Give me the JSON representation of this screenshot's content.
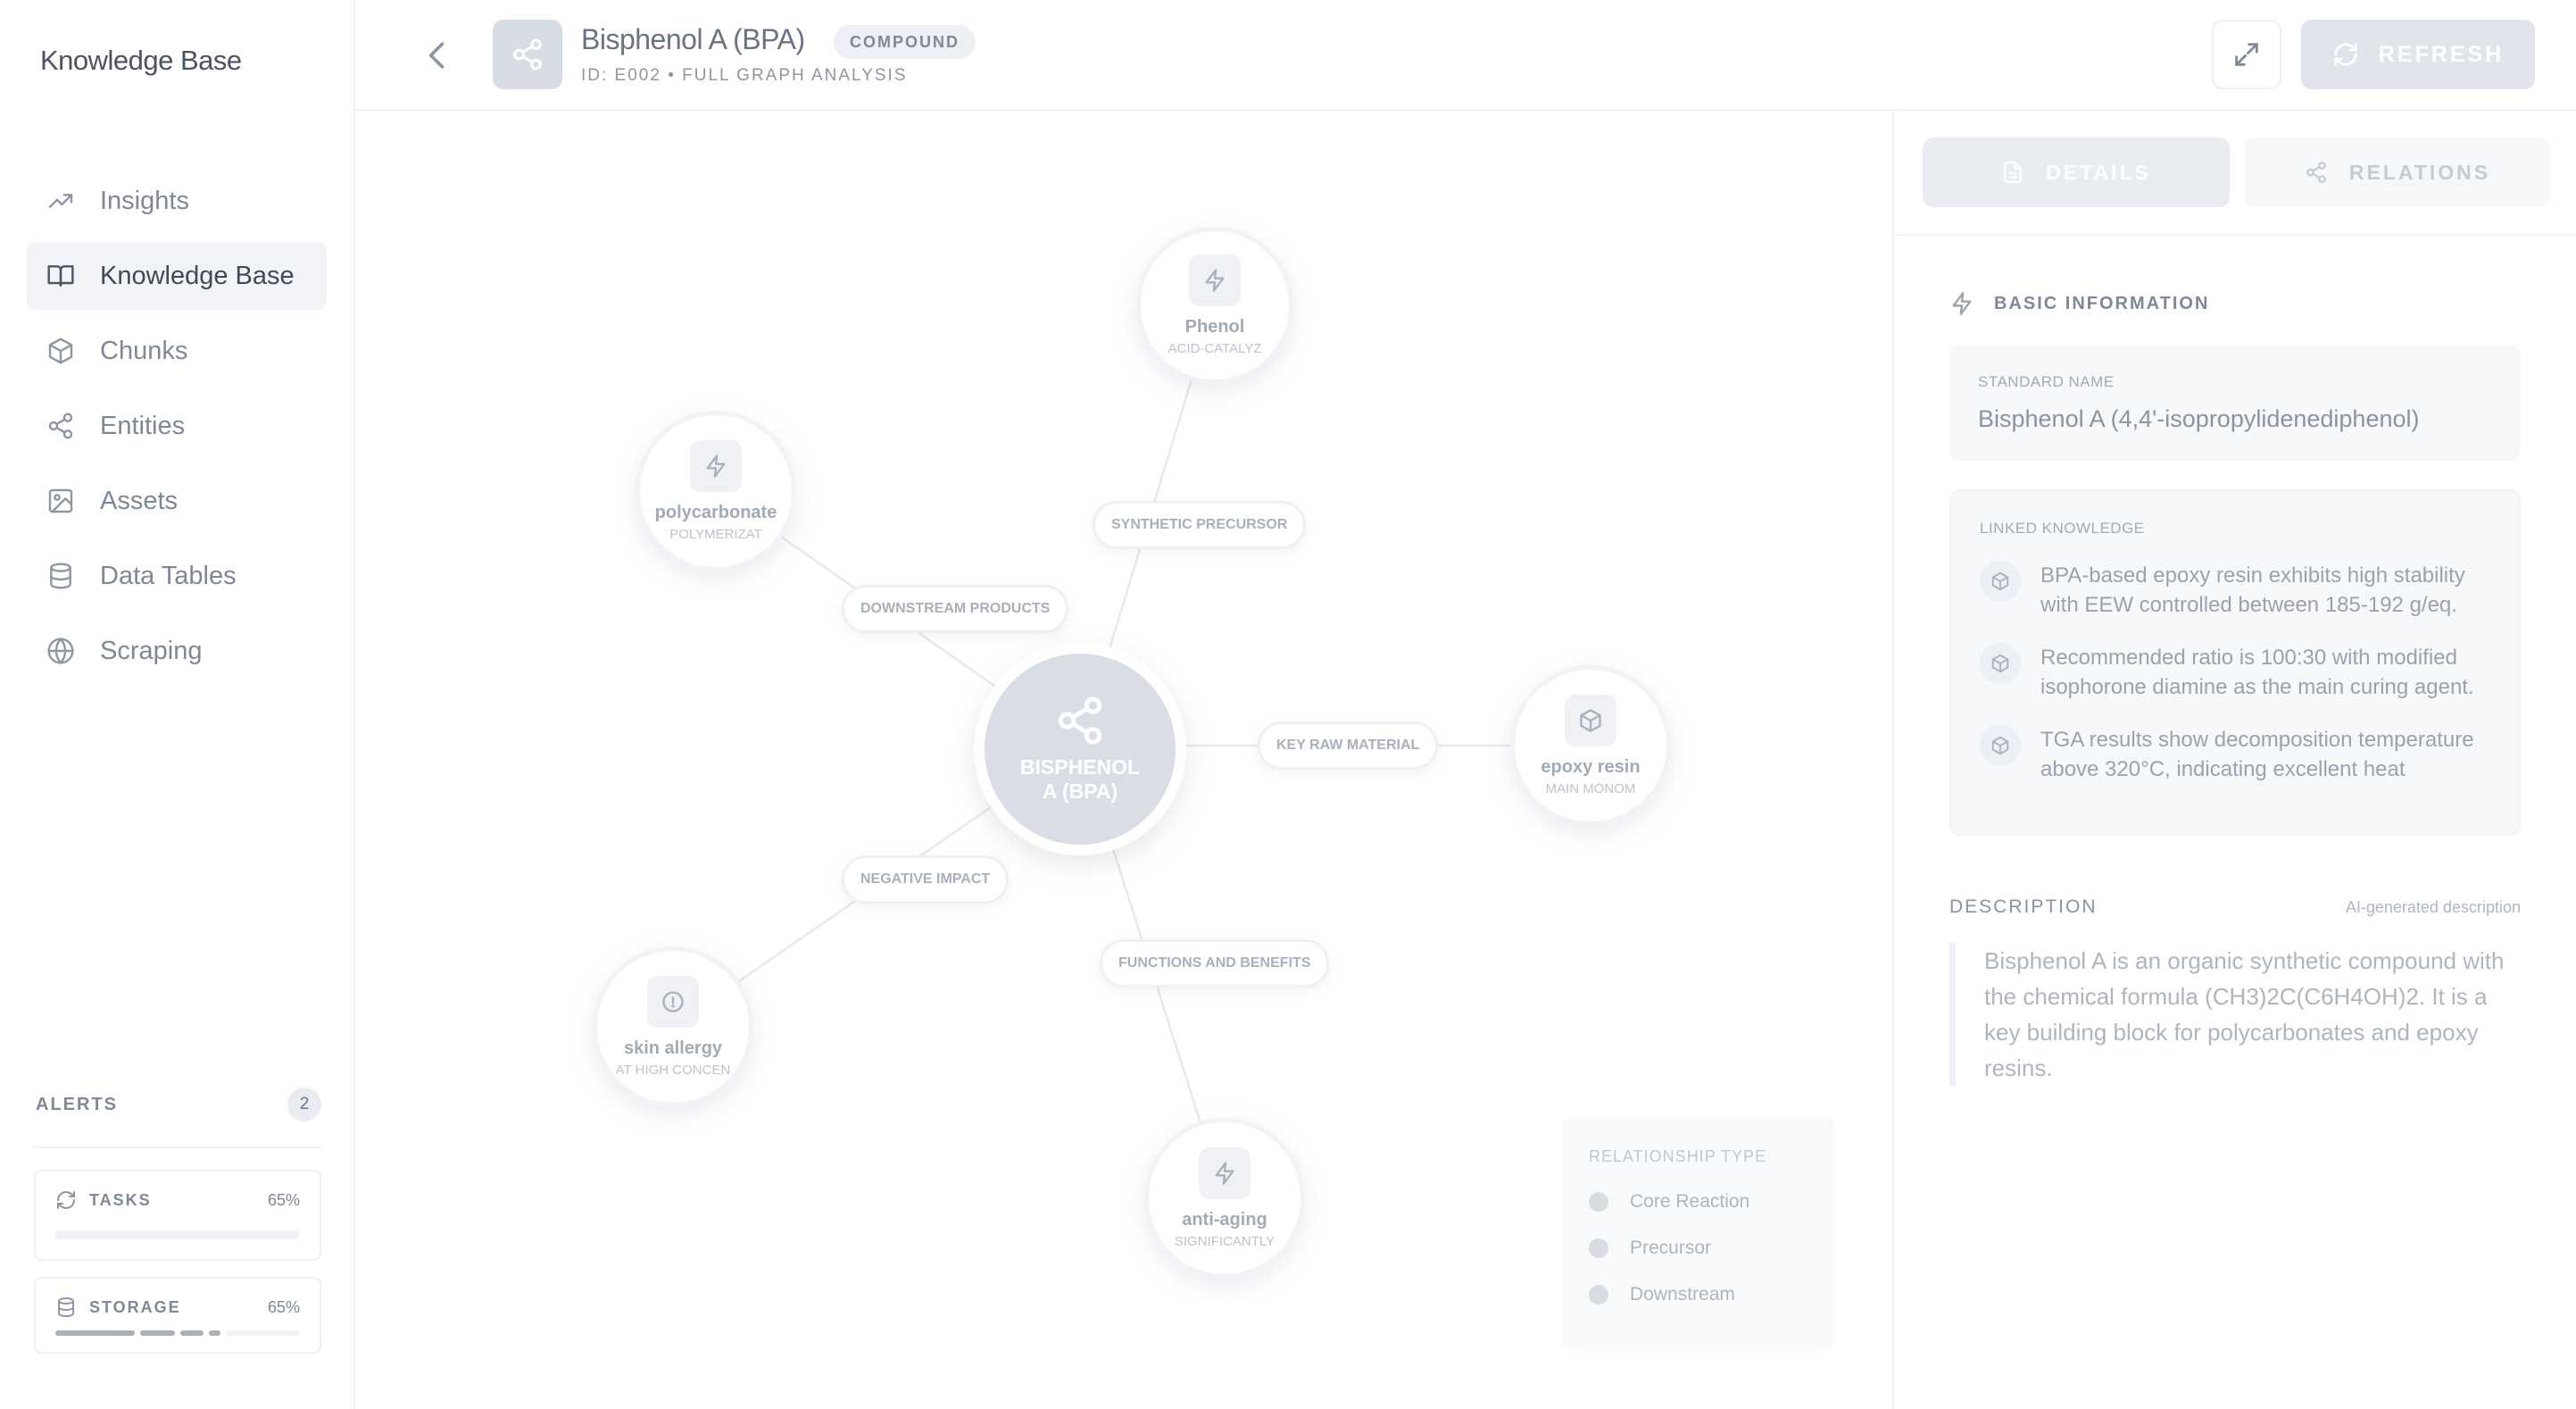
{
  "sidebar": {
    "brand": "Knowledge Base",
    "nav": [
      {
        "label": "Insights",
        "icon": "trending-up-icon"
      },
      {
        "label": "Knowledge Base",
        "icon": "book-icon",
        "active": true
      },
      {
        "label": "Chunks",
        "icon": "cube-icon"
      },
      {
        "label": "Entities",
        "icon": "share-icon"
      },
      {
        "label": "Assets",
        "icon": "image-icon"
      },
      {
        "label": "Data Tables",
        "icon": "database-icon"
      },
      {
        "label": "Scraping",
        "icon": "globe-icon"
      }
    ],
    "alerts": {
      "title": "ALERTS",
      "count": "2"
    },
    "tasks": {
      "label": "TASKS",
      "value": "65%",
      "progress": 0.65
    },
    "storage": {
      "label": "STORAGE",
      "value": "65%",
      "progress": 0.65
    }
  },
  "header": {
    "title": "Bisphenol A (BPA)",
    "badge": "COMPOUND",
    "subtitle": "ID: E002 • FULL GRAPH ANALYSIS",
    "refresh_label": "REFRESH"
  },
  "graph": {
    "center": {
      "label": "BISPHENOL A (BPA)"
    },
    "nodes": [
      {
        "name": "Phenol",
        "sub": "ACID-CATALYZ",
        "icon": "zap-icon"
      },
      {
        "name": "polycarbonate",
        "sub": "POLYMERIZAT",
        "icon": "zap-icon"
      },
      {
        "name": "epoxy resin",
        "sub": "MAIN MONOM",
        "icon": "cube-icon"
      },
      {
        "name": "skin allergy",
        "sub": "AT HIGH CONCEN",
        "icon": "alert-icon"
      },
      {
        "name": "anti-aging",
        "sub": "SIGNIFICANTLY",
        "icon": "zap-icon"
      }
    ],
    "edges": [
      {
        "label": "SYNTHETIC PRECURSOR"
      },
      {
        "label": "DOWNSTREAM PRODUCTS"
      },
      {
        "label": "KEY RAW MATERIAL"
      },
      {
        "label": "NEGATIVE IMPACT"
      },
      {
        "label": "FUNCTIONS AND BENEFITS"
      }
    ],
    "legend": {
      "title": "RELATIONSHIP TYPE",
      "items": [
        "Core Reaction",
        "Precursor",
        "Downstream"
      ]
    }
  },
  "panel": {
    "tabs": [
      {
        "label": "DETAILS",
        "active": true
      },
      {
        "label": "RELATIONS"
      }
    ],
    "basic_info": {
      "title": "BASIC INFORMATION",
      "standard_name_label": "STANDARD NAME",
      "standard_name": "Bisphenol A (4,4'-isopropylidenediphenol)"
    },
    "linked": {
      "title": "LINKED KNOWLEDGE",
      "items": [
        "BPA-based epoxy resin exhibits high stability with EEW controlled between 185-192 g/eq.",
        "Recommended ratio is 100:30 with modified isophorone diamine as the main curing agent.",
        "TGA results show decomposition temperature above 320°C, indicating excellent heat"
      ]
    },
    "description": {
      "title": "DESCRIPTION",
      "meta": "AI-generated description",
      "text": "Bisphenol A is an organic synthetic compound with the chemical formula (CH3)2C(C6H4OH)2. It is a key building block for polycarbonates and epoxy resins."
    }
  },
  "colors": {
    "accent": "#d9dee6",
    "sidebar_active": "#f1f3f7",
    "text": "#5b6472"
  }
}
